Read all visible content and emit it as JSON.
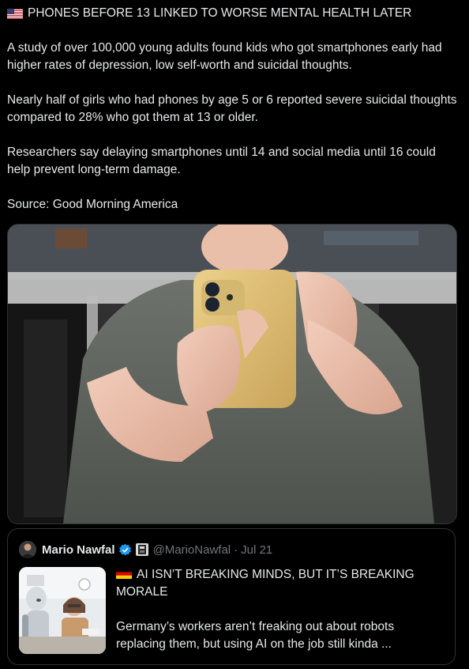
{
  "post": {
    "headline": "PHONES BEFORE 13 LINKED TO WORSE MENTAL HEALTH LATER",
    "headline_flag_icon": "us-flag-icon",
    "paragraphs": [
      "A study of over 100,000 young adults found kids who got smartphones early had higher rates of depression, low self-worth and suicidal thoughts.",
      "Nearly half of girls who had phones by age 5 or 6 reported severe suicidal thoughts compared to 28% who got them at 13 or older.",
      "Researchers say delaying smartphones until 14 and social media until 16 could help prevent long-term damage."
    ],
    "source": "Source: Good Morning America"
  },
  "quoted_post": {
    "author_name": "Mario Nawfal",
    "handle": "@MarioNawfal",
    "separator": "·",
    "date": "Jul 21",
    "verified_icon": "verified-badge-icon",
    "affiliate_icon": "affiliate-badge-icon",
    "title_flag_icon": "germany-flag-icon",
    "title": "AI ISN’T BREAKING MINDS, BUT IT’S BREAKING MORALE",
    "snippet": "Germany’s workers aren’t freaking out about robots replacing them, but using AI on the job still kinda ..."
  },
  "colors": {
    "background": "#000000",
    "text": "#e7e9ea",
    "muted": "#71767b",
    "border": "#2f3336",
    "verified": "#1d9bf0",
    "phone_case": "#e3c272"
  }
}
